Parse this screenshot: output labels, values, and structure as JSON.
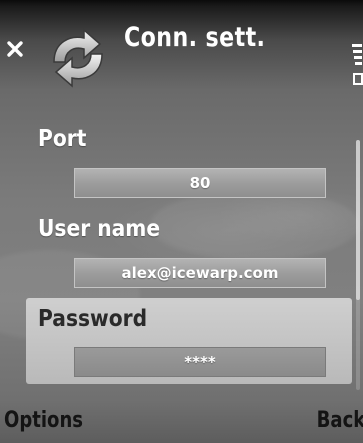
{
  "titlebar": {
    "title": "Conn. sett.",
    "icons": [
      "close-icon",
      "sync-arrows-icon",
      "signal-icon"
    ]
  },
  "settings": {
    "port": {
      "label": "Port",
      "value": "80"
    },
    "user_name": {
      "label": "User name",
      "value": "alex@icewarp.com"
    },
    "password": {
      "label": "Password",
      "value": "****"
    }
  },
  "softkeys": {
    "left": "Options",
    "right": "Back"
  },
  "selected_field": "Password"
}
